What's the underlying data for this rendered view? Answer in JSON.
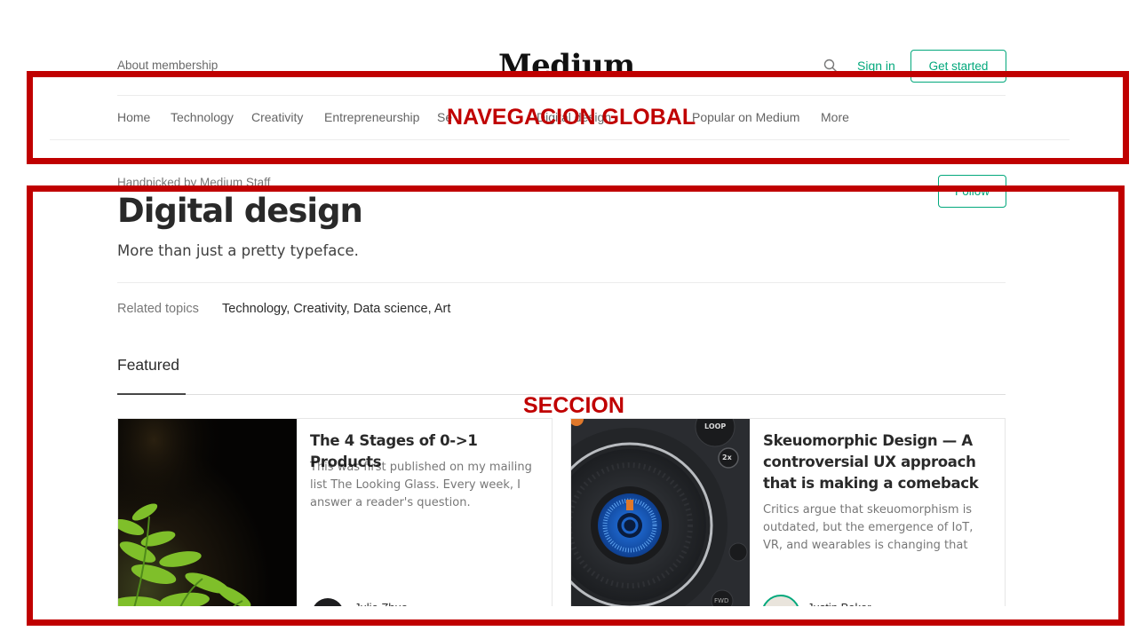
{
  "header": {
    "about_membership": "About membership",
    "logo": "Medium",
    "sign_in": "Sign in",
    "get_started": "Get started"
  },
  "nav": {
    "items": [
      "Home",
      "Technology",
      "Creativity",
      "Entrepreneurship",
      "Se",
      "Digital design",
      "Popular on Medium",
      "More"
    ]
  },
  "topic": {
    "handpicked": "Handpicked by Medium Staff",
    "follow": "Follow",
    "title": "Digital design",
    "subtitle": "More than just a pretty typeface.",
    "related_label": "Related topics",
    "related_topics": "Technology, Creativity, Data science, Art",
    "featured_label": "Featured"
  },
  "cards": [
    {
      "title": "The 4 Stages of 0->1 Products",
      "subtitle": "This was first published on my mailing list The Looking Glass. Every week, I answer a reader's question.",
      "author": "Julie Zhuo"
    },
    {
      "title": "Skeuomorphic Design — A controversial UX approach that is making a comeback",
      "subtitle": "Critics argue that skeuomorphism is outdated, but the emergence of IoT, VR, and wearables is changing that",
      "author": "Justin Baker",
      "image_labels": [
        "LOOP",
        "2x",
        "FWD"
      ]
    }
  ],
  "annotations": {
    "nav_label": "NAVEGACION GLOBAL",
    "section_label": "SECCION",
    "color": "#c00000"
  },
  "colors": {
    "accent": "#03a87c"
  }
}
